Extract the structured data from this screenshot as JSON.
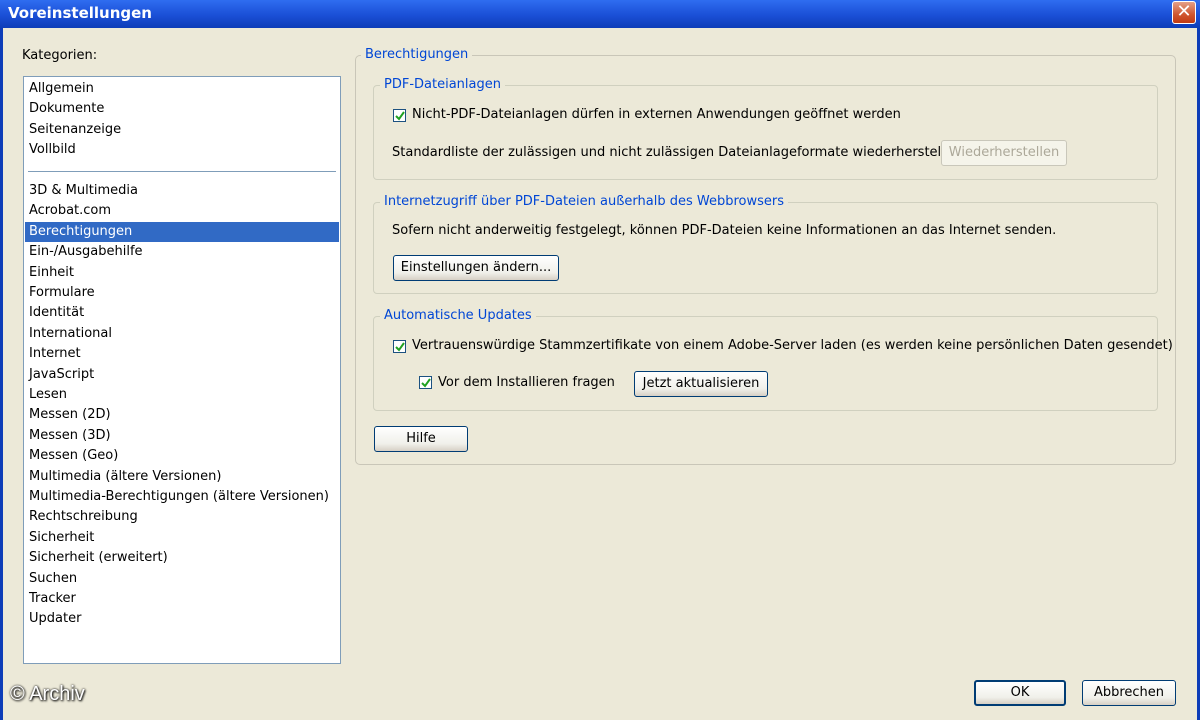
{
  "window": {
    "title": "Voreinstellungen",
    "close_label": "✕"
  },
  "categories": {
    "label": "Kategorien:",
    "group1": [
      "Allgemein",
      "Dokumente",
      "Seitenanzeige",
      "Vollbild"
    ],
    "group2": [
      "3D & Multimedia",
      "Acrobat.com",
      "Berechtigungen",
      "Ein-/Ausgabehilfe",
      "Einheit",
      "Formulare",
      "Identität",
      "International",
      "Internet",
      "JavaScript",
      "Lesen",
      "Messen (2D)",
      "Messen (3D)",
      "Messen (Geo)",
      "Multimedia (ältere Versionen)",
      "Multimedia-Berechtigungen (ältere Versionen)",
      "Rechtschreibung",
      "Sicherheit",
      "Sicherheit (erweitert)",
      "Suchen",
      "Tracker",
      "Updater"
    ],
    "selected": "Berechtigungen"
  },
  "panel": {
    "title": "Berechtigungen",
    "attachments": {
      "title": "PDF-Dateianlagen",
      "checkbox_label": "Nicht-PDF-Dateianlagen dürfen in externen Anwendungen geöffnet werden",
      "checkbox_checked": true,
      "restore_text": "Standardliste der zulässigen und nicht zulässigen Dateianlageformate wiederherstellen:",
      "restore_button": "Wiederherstellen"
    },
    "internet": {
      "title": "Internetzugriff über PDF-Dateien außerhalb des Webbrowsers",
      "text": "Sofern nicht anderweitig festgelegt, können PDF-Dateien keine Informationen an das Internet senden.",
      "button": "Einstellungen ändern..."
    },
    "updates": {
      "title": "Automatische Updates",
      "checkbox_label": "Vertrauenswürdige Stammzertifikate von einem Adobe-Server laden (es werden keine persönlichen Daten gesendet)",
      "checkbox_checked": true,
      "ask_label": "Vor dem Installieren fragen",
      "ask_checked": true,
      "update_button": "Jetzt aktualisieren"
    },
    "help_button": "Hilfe"
  },
  "footer": {
    "ok_button": "OK",
    "cancel_button": "Abbrechen"
  },
  "watermark": "© Archiv",
  "colors": {
    "title_bar": "#1a4fd6",
    "selection": "#316ac5",
    "group_title": "#0046d5"
  }
}
